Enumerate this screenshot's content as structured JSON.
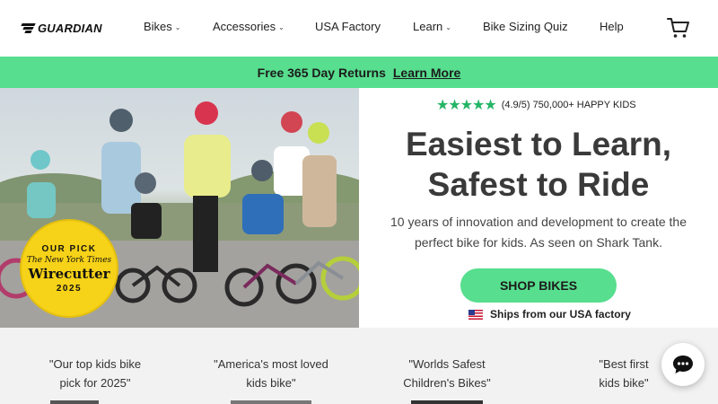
{
  "header": {
    "logo_text": "GUARDIAN",
    "nav": [
      {
        "label": "Bikes"
      },
      {
        "label": "Accessories"
      },
      {
        "label": "USA Factory"
      },
      {
        "label": "Learn"
      },
      {
        "label": "Bike Sizing Quiz"
      },
      {
        "label": "Help"
      }
    ],
    "cart_icon": "cart-icon"
  },
  "banner": {
    "text": "Free 365 Day Returns",
    "link": "Learn More",
    "color": "#57de8e"
  },
  "hero": {
    "badge": {
      "top": "OUR PICK",
      "publication": "The New York Times",
      "name": "Wirecutter",
      "year": "2025"
    },
    "rating_stars": "★★★★★",
    "rating_text": "(4.9/5) 750,000+ HAPPY KIDS",
    "headline_line1": "Easiest to Learn,",
    "headline_line2": "Safest to Ride",
    "subtext": "10 years of innovation and development to create the perfect bike for kids. As seen on Shark Tank.",
    "cta": "SHOP BIKES",
    "ships_text": "Ships from our USA factory"
  },
  "quotes": [
    {
      "line1": "\"Our top kids bike",
      "line2": "pick for 2025\""
    },
    {
      "line1": "\"America's most loved",
      "line2": "kids bike\""
    },
    {
      "line1": "\"Worlds Safest",
      "line2": "Children's Bikes\""
    },
    {
      "line1": "\"Best first",
      "line2": "kids bike\""
    }
  ],
  "colors": {
    "accent": "#57de8e",
    "star": "#25b566",
    "badge": "#f6d218"
  }
}
